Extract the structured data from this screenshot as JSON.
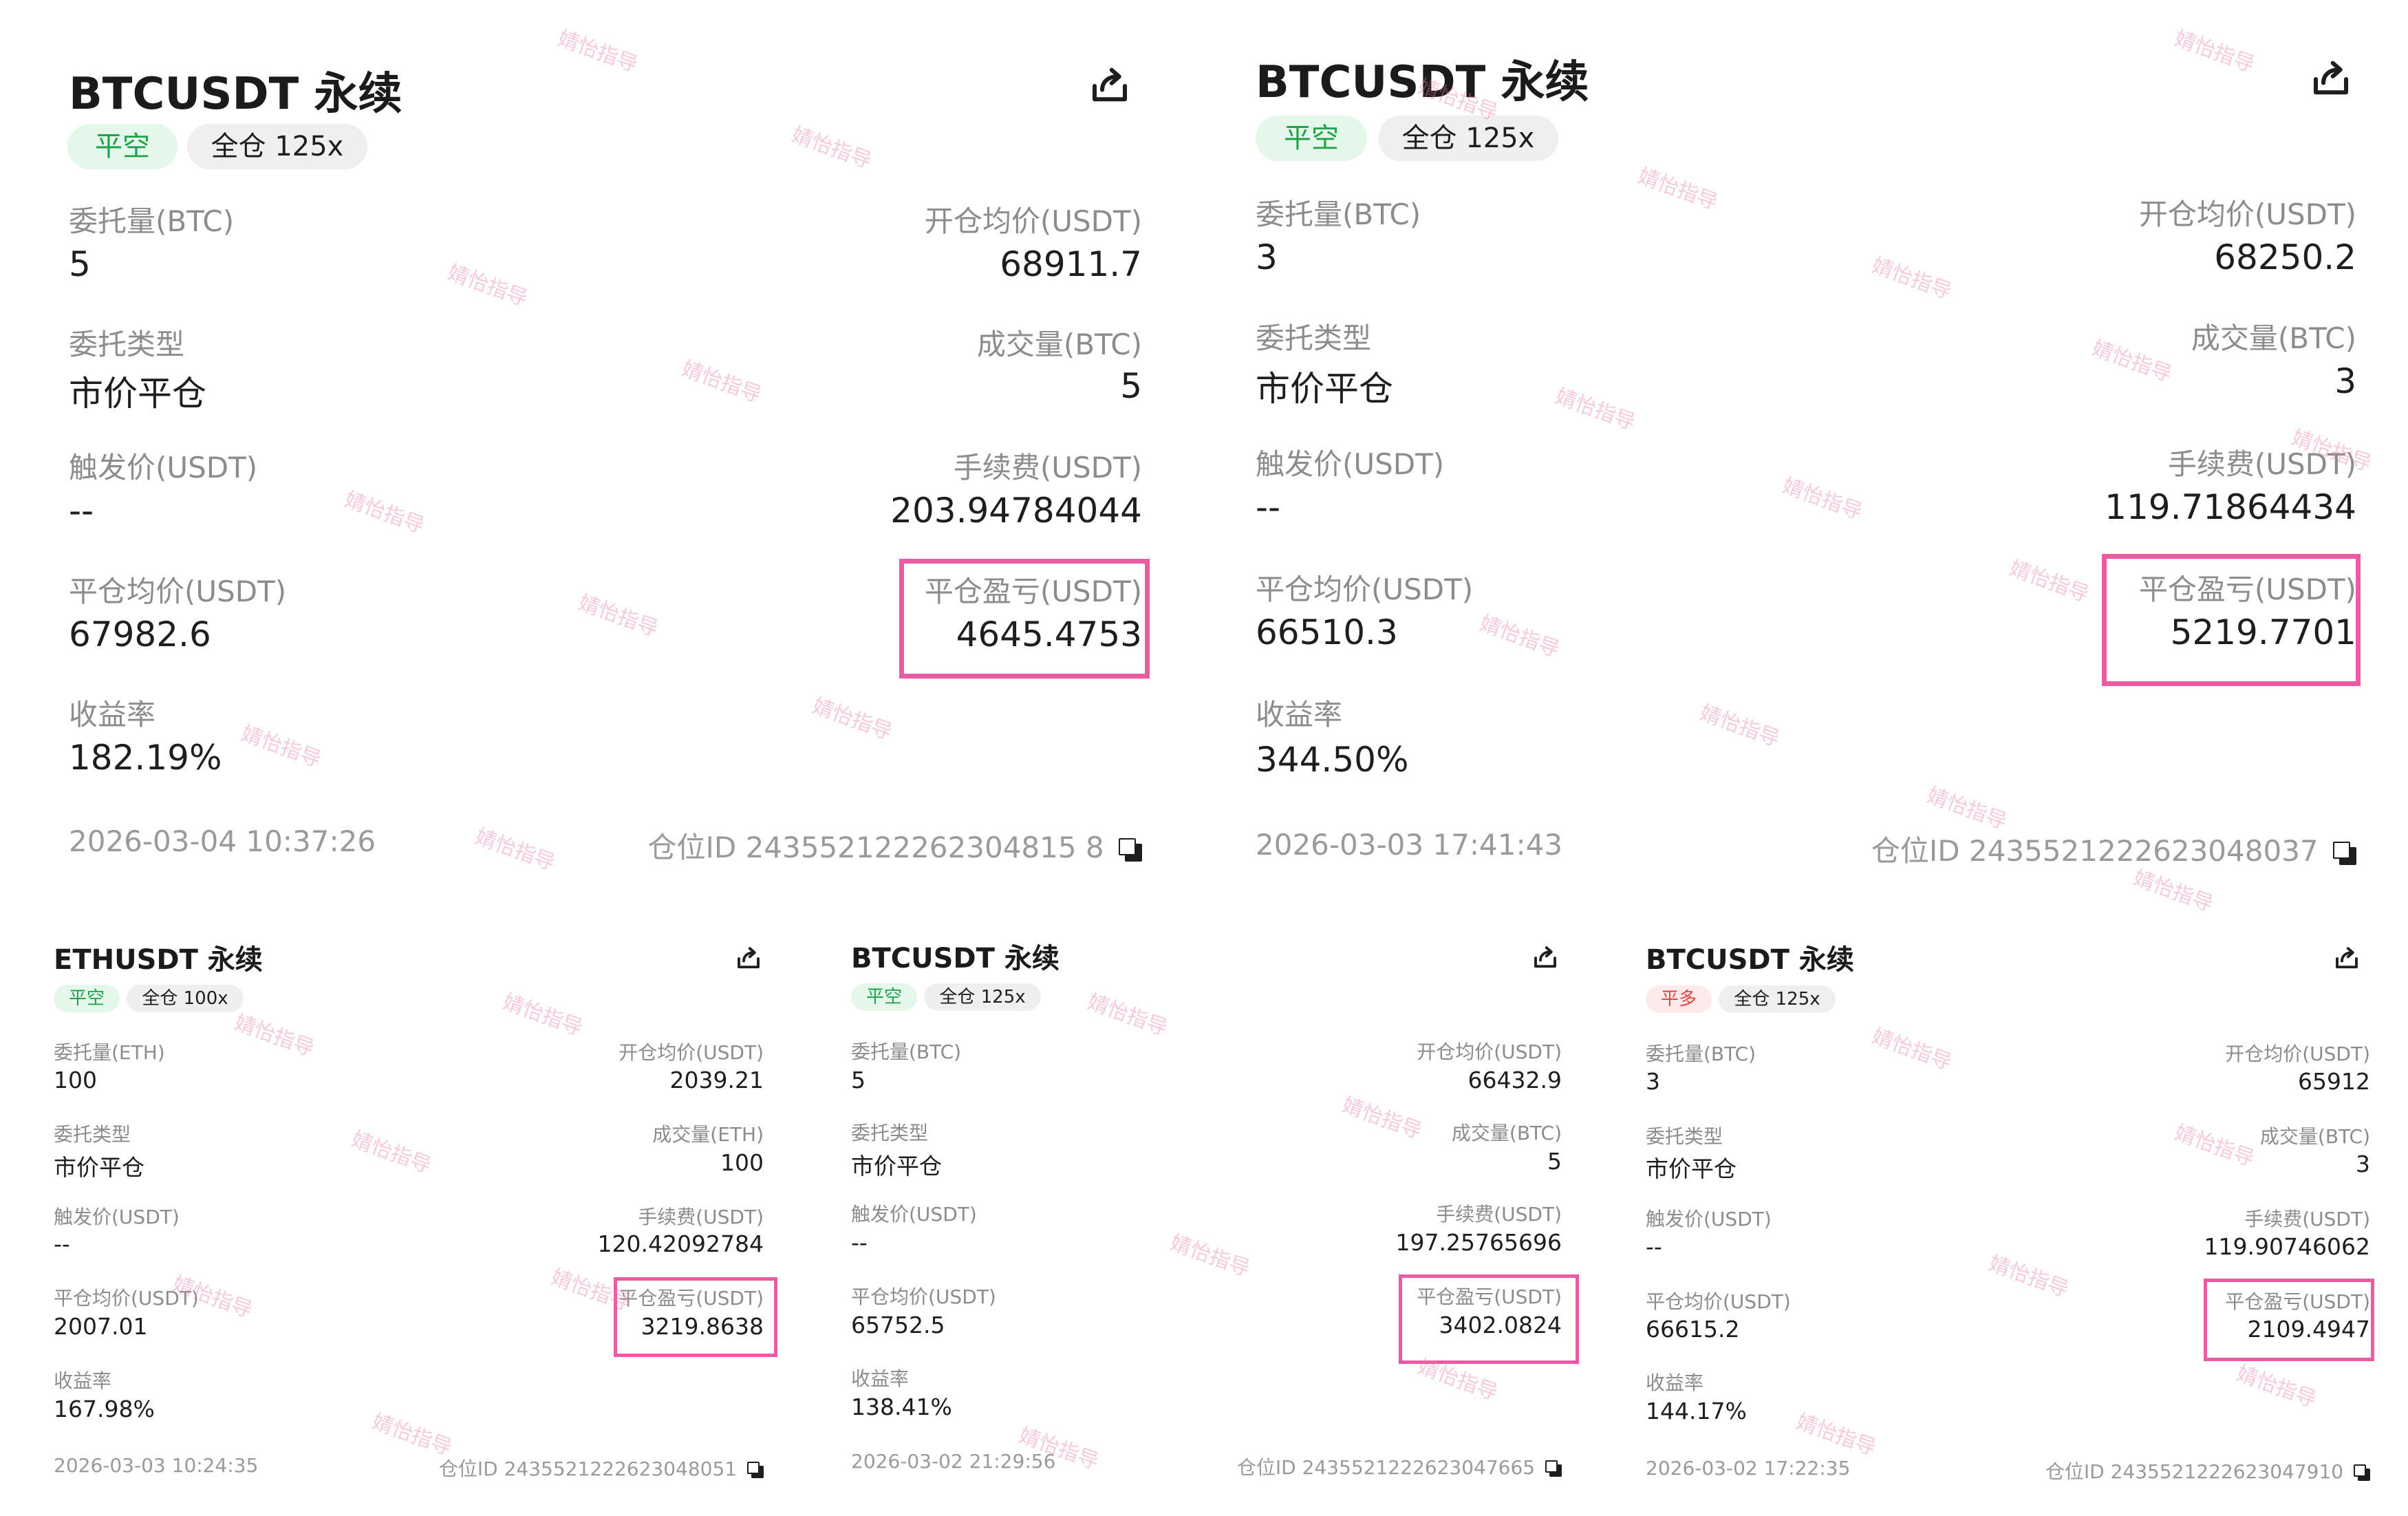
{
  "labels": {
    "order_qty_btc": "委托量(BTC)",
    "order_qty_eth": "委托量(ETH)",
    "order_type": "委托类型",
    "trigger_price": "触发价(USDT)",
    "close_avg_price": "平仓均价(USDT)",
    "return_rate": "收益率",
    "open_avg_price": "开仓均价(USDT)",
    "filled_btc": "成交量(BTC)",
    "filled_eth": "成交量(ETH)",
    "fee": "手续费(USDT)",
    "close_pnl": "平仓盈亏(USDT)",
    "position_id_prefix": "仓位ID "
  },
  "watermark_text": "婧怡指导",
  "colors": {
    "highlight_box": "#ec5aa3",
    "short_badge_text": "#1fa34a",
    "long_badge_text": "#e04848"
  },
  "cards": [
    {
      "title": "BTCUSDT 永续",
      "side": "平空",
      "side_color": "green",
      "margin": "全仓 125x",
      "order_qty": "5",
      "order_type": "市价平仓",
      "trigger_price": "--",
      "close_avg_price": "67982.6",
      "return_rate": "182.19%",
      "open_avg_price": "68911.7",
      "filled": "5",
      "fee": "203.94784044",
      "close_pnl": "4645.4753",
      "time": "2026-03-04 10:37:26",
      "position_id": "243552122262304815 8"
    },
    {
      "title": "BTCUSDT 永续",
      "side": "平空",
      "side_color": "green",
      "margin": "全仓 125x",
      "order_qty": "3",
      "order_type": "市价平仓",
      "trigger_price": "--",
      "close_avg_price": "66510.3",
      "return_rate": "344.50%",
      "open_avg_price": "68250.2",
      "filled": "3",
      "fee": "119.71864434",
      "close_pnl": "5219.7701",
      "time": "2026-03-03 17:41:43",
      "position_id": "2435521222623048037"
    },
    {
      "title": "ETHUSDT 永续",
      "side": "平空",
      "side_color": "green",
      "margin": "全仓 100x",
      "order_qty": "100",
      "order_type": "市价平仓",
      "trigger_price": "--",
      "close_avg_price": "2007.01",
      "return_rate": "167.98%",
      "open_avg_price": "2039.21",
      "filled": "100",
      "fee": "120.42092784",
      "close_pnl": "3219.8638",
      "time": "2026-03-03 10:24:35",
      "position_id": "2435521222623048051"
    },
    {
      "title": "BTCUSDT 永续",
      "side": "平空",
      "side_color": "green",
      "margin": "全仓 125x",
      "order_qty": "5",
      "order_type": "市价平仓",
      "trigger_price": "--",
      "close_avg_price": "65752.5",
      "return_rate": "138.41%",
      "open_avg_price": "66432.9",
      "filled": "5",
      "fee": "197.25765696",
      "close_pnl": "3402.0824",
      "time": "2026-03-02 21:29:56",
      "position_id": "2435521222623047665"
    },
    {
      "title": "BTCUSDT 永续",
      "side": "平多",
      "side_color": "red",
      "margin": "全仓 125x",
      "order_qty": "3",
      "order_type": "市价平仓",
      "trigger_price": "--",
      "close_avg_price": "66615.2",
      "return_rate": "144.17%",
      "open_avg_price": "65912",
      "filled": "3",
      "fee": "119.90746062",
      "close_pnl": "2109.4947",
      "time": "2026-03-02 17:22:35",
      "position_id": "2435521222623047910"
    }
  ]
}
